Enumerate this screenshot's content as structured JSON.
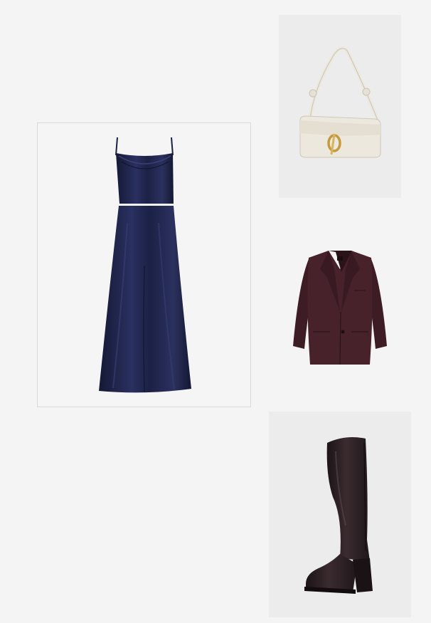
{
  "board": {
    "background": "#f4f4f4",
    "items": [
      {
        "name": "dress",
        "icon": "satin-slip-dress-icon",
        "color": "#1c2146"
      },
      {
        "name": "bag",
        "icon": "shoulder-bag-icon",
        "color": "#ece8dd"
      },
      {
        "name": "blazer",
        "icon": "blazer-icon",
        "color": "#47222b"
      },
      {
        "name": "boot",
        "icon": "knee-high-boot-icon",
        "color": "#2a1f22"
      }
    ]
  }
}
